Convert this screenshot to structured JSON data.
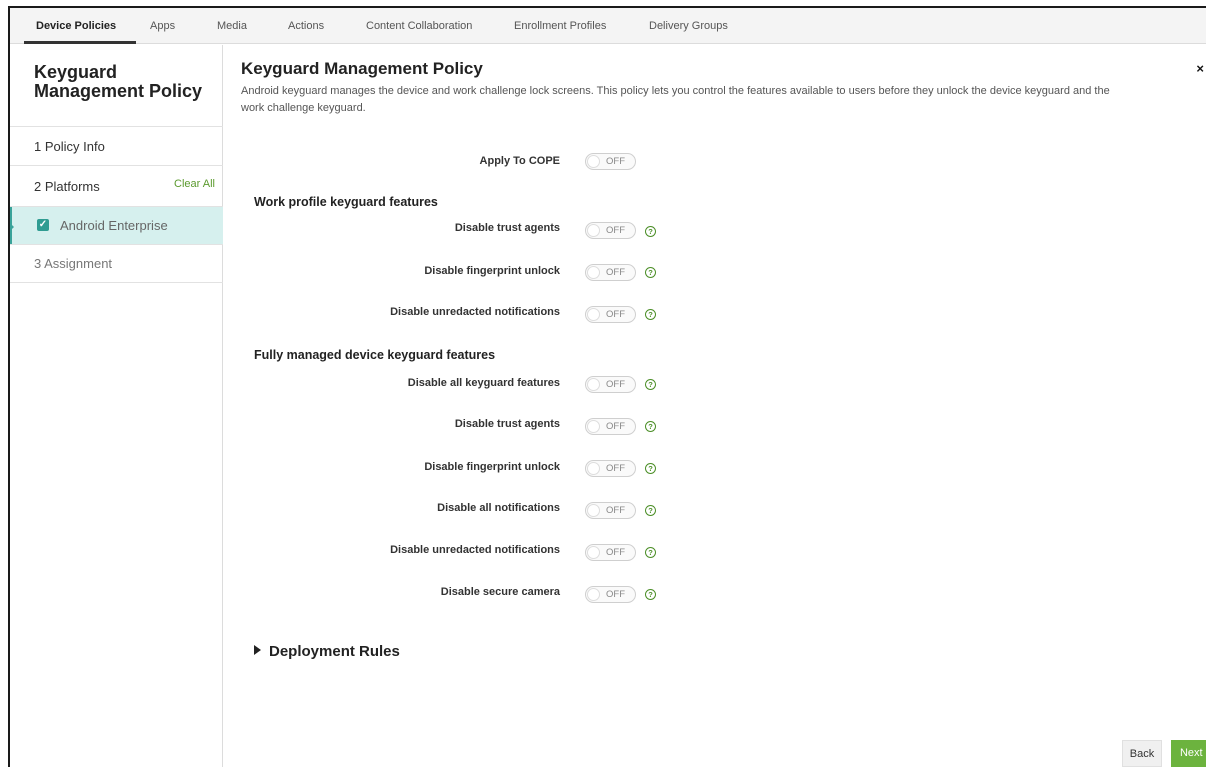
{
  "tabs": [
    {
      "label": "Device Policies"
    },
    {
      "label": "Apps"
    },
    {
      "label": "Media"
    },
    {
      "label": "Actions"
    },
    {
      "label": "Content Collaboration"
    },
    {
      "label": "Enrollment Profiles"
    },
    {
      "label": "Delivery Groups"
    }
  ],
  "sidebar": {
    "title": "Keyguard Management Policy",
    "items": [
      {
        "label": "1  Policy Info"
      },
      {
        "label": "2  Platforms",
        "action": "Clear All"
      },
      {
        "label": "Android Enterprise",
        "checked": true
      },
      {
        "label": "3  Assignment"
      }
    ]
  },
  "main": {
    "title": "Keyguard Management Policy",
    "description": "Android keyguard manages the device and work challenge lock screens. This policy lets you control the features available to users before they unlock the device keyguard and the work challenge keyguard.",
    "close": "×",
    "apply_cope": {
      "label": "Apply To COPE",
      "state": "OFF"
    },
    "work_profile": {
      "heading": "Work profile keyguard features",
      "fields": [
        {
          "label": "Disable trust agents",
          "state": "OFF"
        },
        {
          "label": "Disable fingerprint unlock",
          "state": "OFF"
        },
        {
          "label": "Disable unredacted notifications",
          "state": "OFF"
        }
      ]
    },
    "fully_managed": {
      "heading": "Fully managed device keyguard features",
      "fields": [
        {
          "label": "Disable all keyguard features",
          "state": "OFF"
        },
        {
          "label": "Disable trust agents",
          "state": "OFF"
        },
        {
          "label": "Disable fingerprint unlock",
          "state": "OFF"
        },
        {
          "label": "Disable all notifications",
          "state": "OFF"
        },
        {
          "label": "Disable unredacted notifications",
          "state": "OFF"
        },
        {
          "label": "Disable secure camera",
          "state": "OFF"
        }
      ]
    },
    "deployment_rules": "Deployment Rules",
    "help_glyph": "?",
    "buttons": {
      "back": "Back",
      "next": "Next >"
    }
  },
  "colors": {
    "accent_green": "#6cb33e",
    "selected_bg": "#d6f0ee",
    "help_green": "#4c8f28"
  }
}
